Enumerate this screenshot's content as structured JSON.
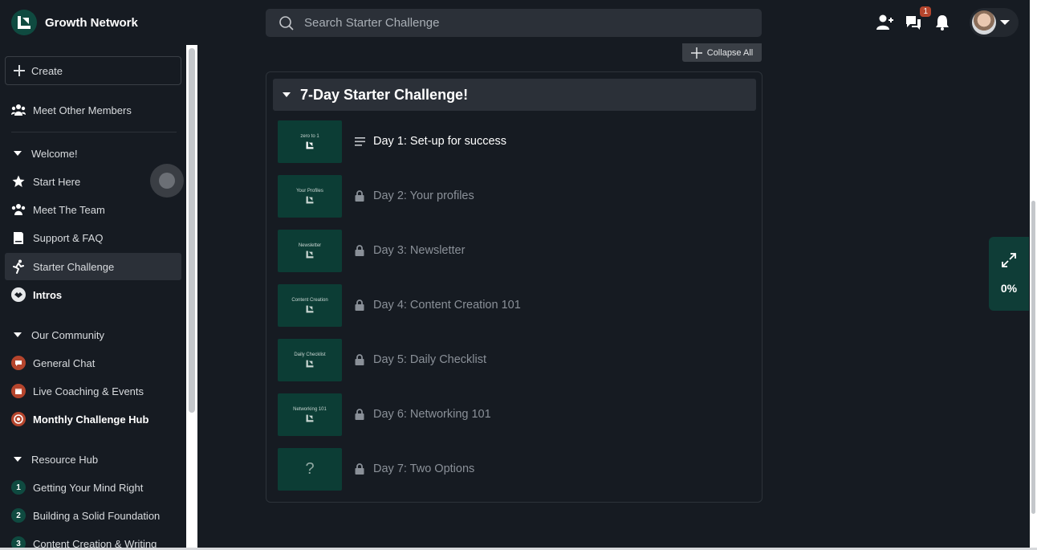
{
  "brand": {
    "name": "Growth Network"
  },
  "search": {
    "placeholder": "Search Starter Challenge"
  },
  "topbar": {
    "notification_count": "1"
  },
  "sidebar": {
    "create_label": "Create",
    "meet_members": "Meet Other Members",
    "sections": {
      "welcome": "Welcome!",
      "community": "Our Community",
      "resources": "Resource Hub"
    },
    "welcome_items": [
      "Start Here",
      "Meet The Team",
      "Support & FAQ",
      "Starter Challenge",
      "Intros"
    ],
    "community_items": [
      "General Chat",
      "Live Coaching & Events",
      "Monthly Challenge Hub"
    ],
    "resource_items": [
      "Getting Your Mind Right",
      "Building a Solid Foundation",
      "Content Creation & Writing"
    ]
  },
  "main": {
    "collapse_label": "Collapse All",
    "course_title": "7-Day Starter Challenge!",
    "lessons": [
      {
        "thumb": "zero to 1",
        "title": "Day 1: Set-up for success",
        "locked": false
      },
      {
        "thumb": "Your Profiles",
        "title": "Day 2: Your profiles",
        "locked": true
      },
      {
        "thumb": "Newsletter",
        "title": "Day 3: Newsletter",
        "locked": true
      },
      {
        "thumb": "Content Creation",
        "title": "Day 4: Content Creation 101",
        "locked": true
      },
      {
        "thumb": "Daily Checklist",
        "title": "Day 5: Daily Checklist",
        "locked": true
      },
      {
        "thumb": "Networking 101",
        "title": "Day 6: Networking 101",
        "locked": true
      },
      {
        "thumb": "?",
        "title": "Day 7: Two Options",
        "locked": true
      }
    ]
  },
  "progress": {
    "value": "0%"
  },
  "colors": {
    "accent": "#0f3d37",
    "background": "#161b22",
    "panel_head": "#2b3038"
  }
}
